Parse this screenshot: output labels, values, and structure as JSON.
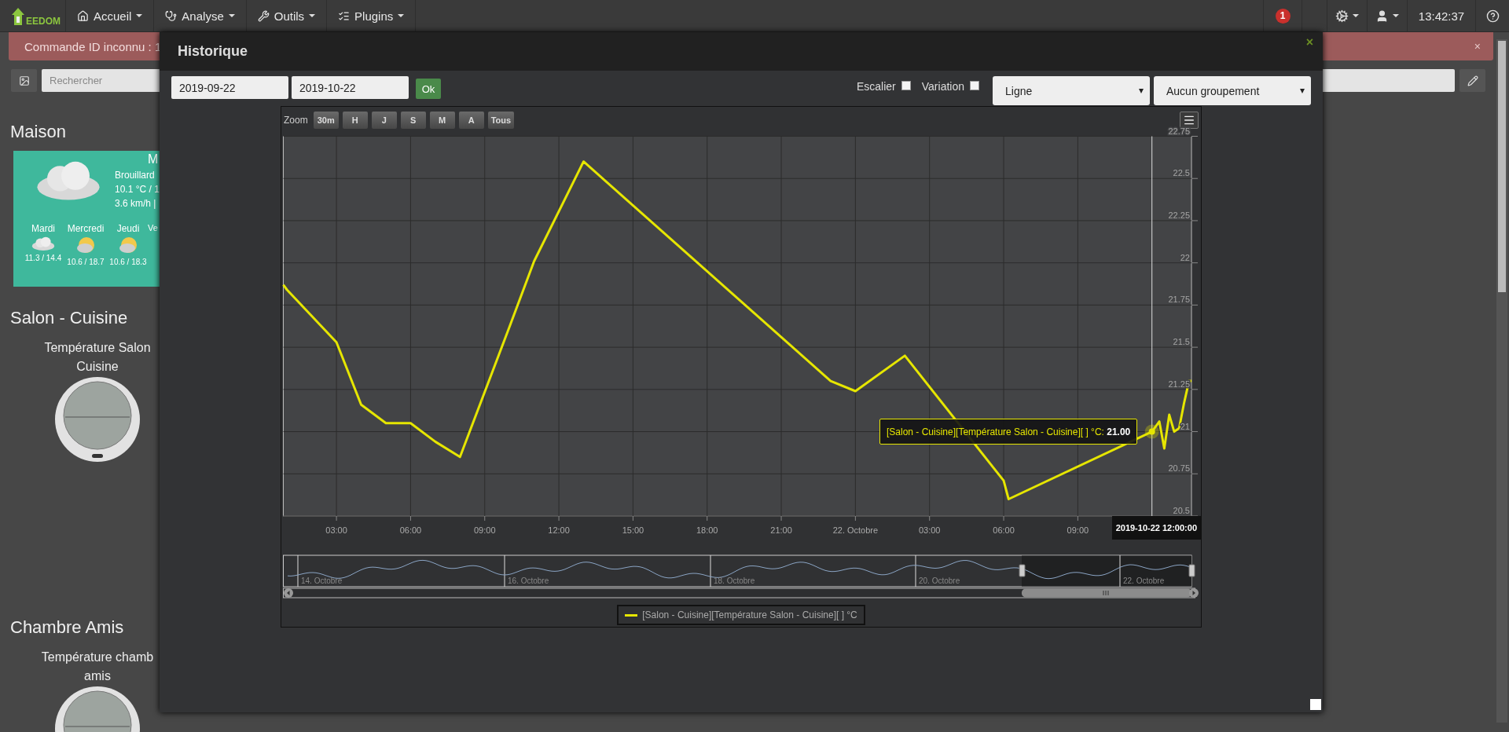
{
  "navbar": {
    "logo": "EEDOM",
    "menus": [
      {
        "label": "Accueil"
      },
      {
        "label": "Analyse"
      },
      {
        "label": "Outils"
      },
      {
        "label": "Plugins"
      }
    ],
    "notification_count": "1",
    "time": "13:42:37"
  },
  "alert": {
    "message": "Commande ID inconnu : 1",
    "close": "×"
  },
  "search": {
    "placeholder": "Rechercher"
  },
  "objects": [
    {
      "kind": "weather",
      "title": "Maison",
      "card_title": "M",
      "condition": "Brouillard",
      "temperature": "10.1 °C / 1",
      "wind": "3.6 km/h |",
      "forecast": [
        {
          "day": "Mardi",
          "temps": "11.3 / 14.4",
          "kind": "cloudy"
        },
        {
          "day": "Mercredi",
          "temps": "10.6 / 18.7",
          "kind": "sun_cloud"
        },
        {
          "day": "Jeudi",
          "temps": "10.6 / 18.3",
          "kind": "sun_cloud"
        },
        {
          "day": "Ve"
        }
      ]
    },
    {
      "kind": "thermometer",
      "title": "Salon - Cuisine",
      "widget_title_lines": [
        "Température Salon",
        "Cuisine"
      ]
    },
    {
      "kind": "thermometer",
      "title": "Chambre Amis",
      "widget_title_lines": [
        "Température chamb",
        "amis"
      ]
    }
  ],
  "modal": {
    "title": "Historique",
    "close": "×",
    "start_date": "2019-09-22",
    "end_date": "2019-10-22",
    "ok": "Ok",
    "options": [
      {
        "label": "Escalier",
        "checked": false
      },
      {
        "label": "Variation",
        "checked": false
      }
    ],
    "chart_type": "Ligne",
    "grouping": "Aucun groupement",
    "chart": {
      "zoom_label": "Zoom",
      "zoom_buttons": [
        {
          "label": "30m",
          "selected": false
        },
        {
          "label": "H",
          "selected": false
        },
        {
          "label": "J",
          "selected": false
        },
        {
          "label": "S",
          "selected": false
        },
        {
          "label": "M",
          "selected": false
        },
        {
          "label": "A",
          "selected": false
        },
        {
          "label": "Tous",
          "selected": false
        }
      ],
      "tooltip": "[Salon - Cuisine][Température Salon - Cuisine][ ] °C: **21.00**",
      "navigator_labels": [
        "14. Octobre",
        "16. Octobre",
        "18. Octobre",
        "20. Octobre",
        "22. Octobre"
      ],
      "chart_data": {
        "type": "line",
        "grid": true,
        "x": [
          "2019-10-21T00:51",
          "2019-10-21T01:00",
          "2019-10-21T03:00",
          "2019-10-21T04:00",
          "2019-10-21T05:00",
          "2019-10-21T06:00",
          "2019-10-21T07:00",
          "2019-10-21T08:00",
          "2019-10-21T10:00",
          "2019-10-21T11:00",
          "2019-10-21T13:00",
          "2019-10-21T23:00",
          "2019-10-22T00:00",
          "2019-10-22T02:00",
          "2019-10-22T06:00",
          "2019-10-22T06:12",
          "2019-10-22T12:00",
          "2019-10-22T12:18",
          "2019-10-22T12:30",
          "2019-10-22T12:42",
          "2019-10-22T12:54",
          "2019-10-22T13:06",
          "2019-10-22T13:18",
          "2019-10-22T13:30",
          "2019-10-22T13:36"
        ],
        "series": [
          {
            "name": "[Salon - Cuisine][Température Salon - Cuisine][ ] °C",
            "color": "#e6e600",
            "values": [
              21.87,
              21.84,
              21.53,
              21.16,
              21.05,
              21.05,
              20.94,
              20.85,
              21.62,
              22.01,
              22.6,
              21.3,
              21.24,
              21.45,
              20.71,
              20.6,
              21.0,
              21.06,
              20.9,
              21.1,
              21.0,
              21.02,
              21.17,
              21.3,
              21.3
            ]
          }
        ],
        "xlim": [
          "2019-10-21T00:51",
          "2019-10-22T13:36"
        ],
        "ylim": [
          20.5,
          22.75
        ],
        "xticks": [
          {
            "value": "2019-10-21T03:00",
            "label": "03:00"
          },
          {
            "value": "2019-10-21T06:00",
            "label": "06:00"
          },
          {
            "value": "2019-10-21T09:00",
            "label": "09:00"
          },
          {
            "value": "2019-10-21T12:00",
            "label": "12:00"
          },
          {
            "value": "2019-10-21T15:00",
            "label": "15:00"
          },
          {
            "value": "2019-10-21T18:00",
            "label": "18:00"
          },
          {
            "value": "2019-10-21T21:00",
            "label": "21:00"
          },
          {
            "value": "2019-10-22T00:00",
            "label": "22. Octobre"
          },
          {
            "value": "2019-10-22T03:00",
            "label": "03:00"
          },
          {
            "value": "2019-10-22T06:00",
            "label": "06:00"
          },
          {
            "value": "2019-10-22T09:00",
            "label": "09:00"
          }
        ],
        "yticks": [
          20.5,
          20.75,
          21,
          21.25,
          21.5,
          21.75,
          22,
          22.25,
          22.5,
          22.75
        ],
        "ref_lines": [
          {
            "axis": "x",
            "value": "2019-10-22T12:00"
          }
        ]
      },
      "crosshair_label": "2019-10-22 12:00:00"
    }
  }
}
